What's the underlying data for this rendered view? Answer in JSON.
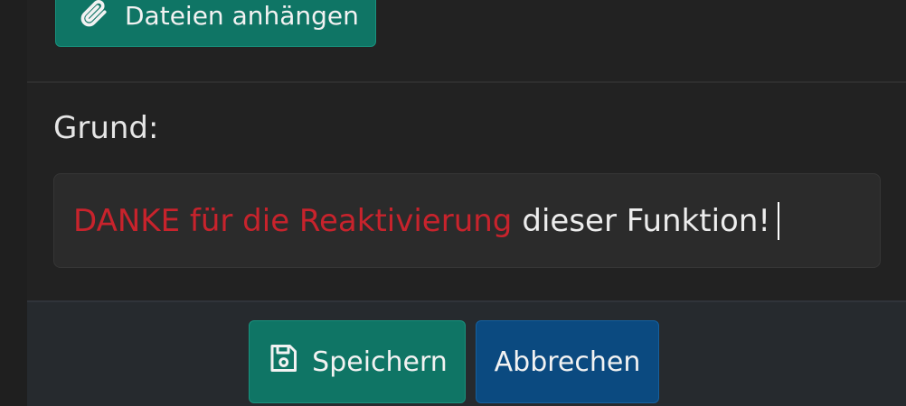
{
  "attach": {
    "label": "Dateien anhängen",
    "icon": "paperclip-icon"
  },
  "form": {
    "reason_label": "Grund:",
    "reason_value_highlight": "DANKE für die Reaktivierung",
    "reason_value_rest": "dieser Funktion!"
  },
  "footer": {
    "save_label": "Speichern",
    "save_icon": "floppy-disk-icon",
    "cancel_label": "Abbrechen"
  },
  "colors": {
    "background": "#1f1f1f",
    "primary_button": "#0f7565",
    "secondary_button": "#0b4a80",
    "highlight_text": "#c8232c"
  }
}
